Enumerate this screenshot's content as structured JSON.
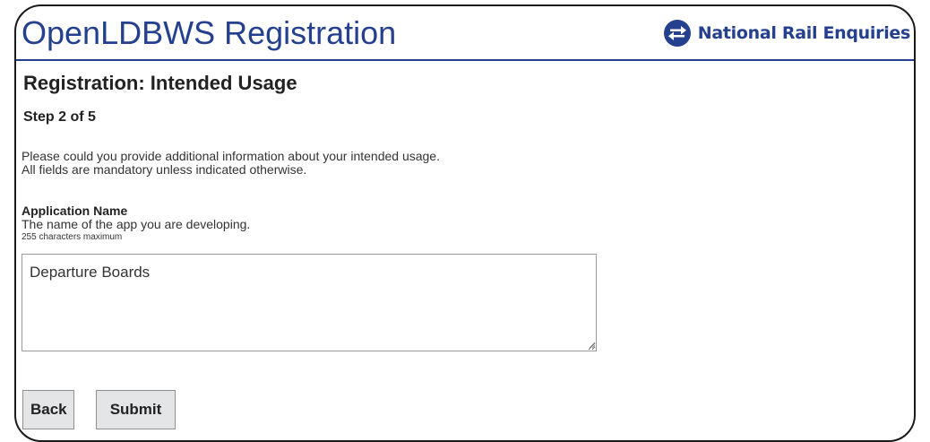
{
  "header": {
    "title": "OpenLDBWS Registration",
    "brand": {
      "name": "National Rail Enquiries",
      "icon": "national-rail-double-arrow-icon",
      "color": "#24408e"
    }
  },
  "page": {
    "heading": "Registration: Intended Usage",
    "step": "Step 2 of 5",
    "intro": [
      "Please could you provide additional information about your intended usage.",
      "All fields are mandatory unless indicated otherwise."
    ]
  },
  "form": {
    "application_name": {
      "label": "Application Name",
      "help": "The name of the app you are developing.",
      "limit": "255 characters maximum",
      "value": "Departure Boards"
    }
  },
  "actions": {
    "back_label": "Back",
    "submit_label": "Submit"
  }
}
